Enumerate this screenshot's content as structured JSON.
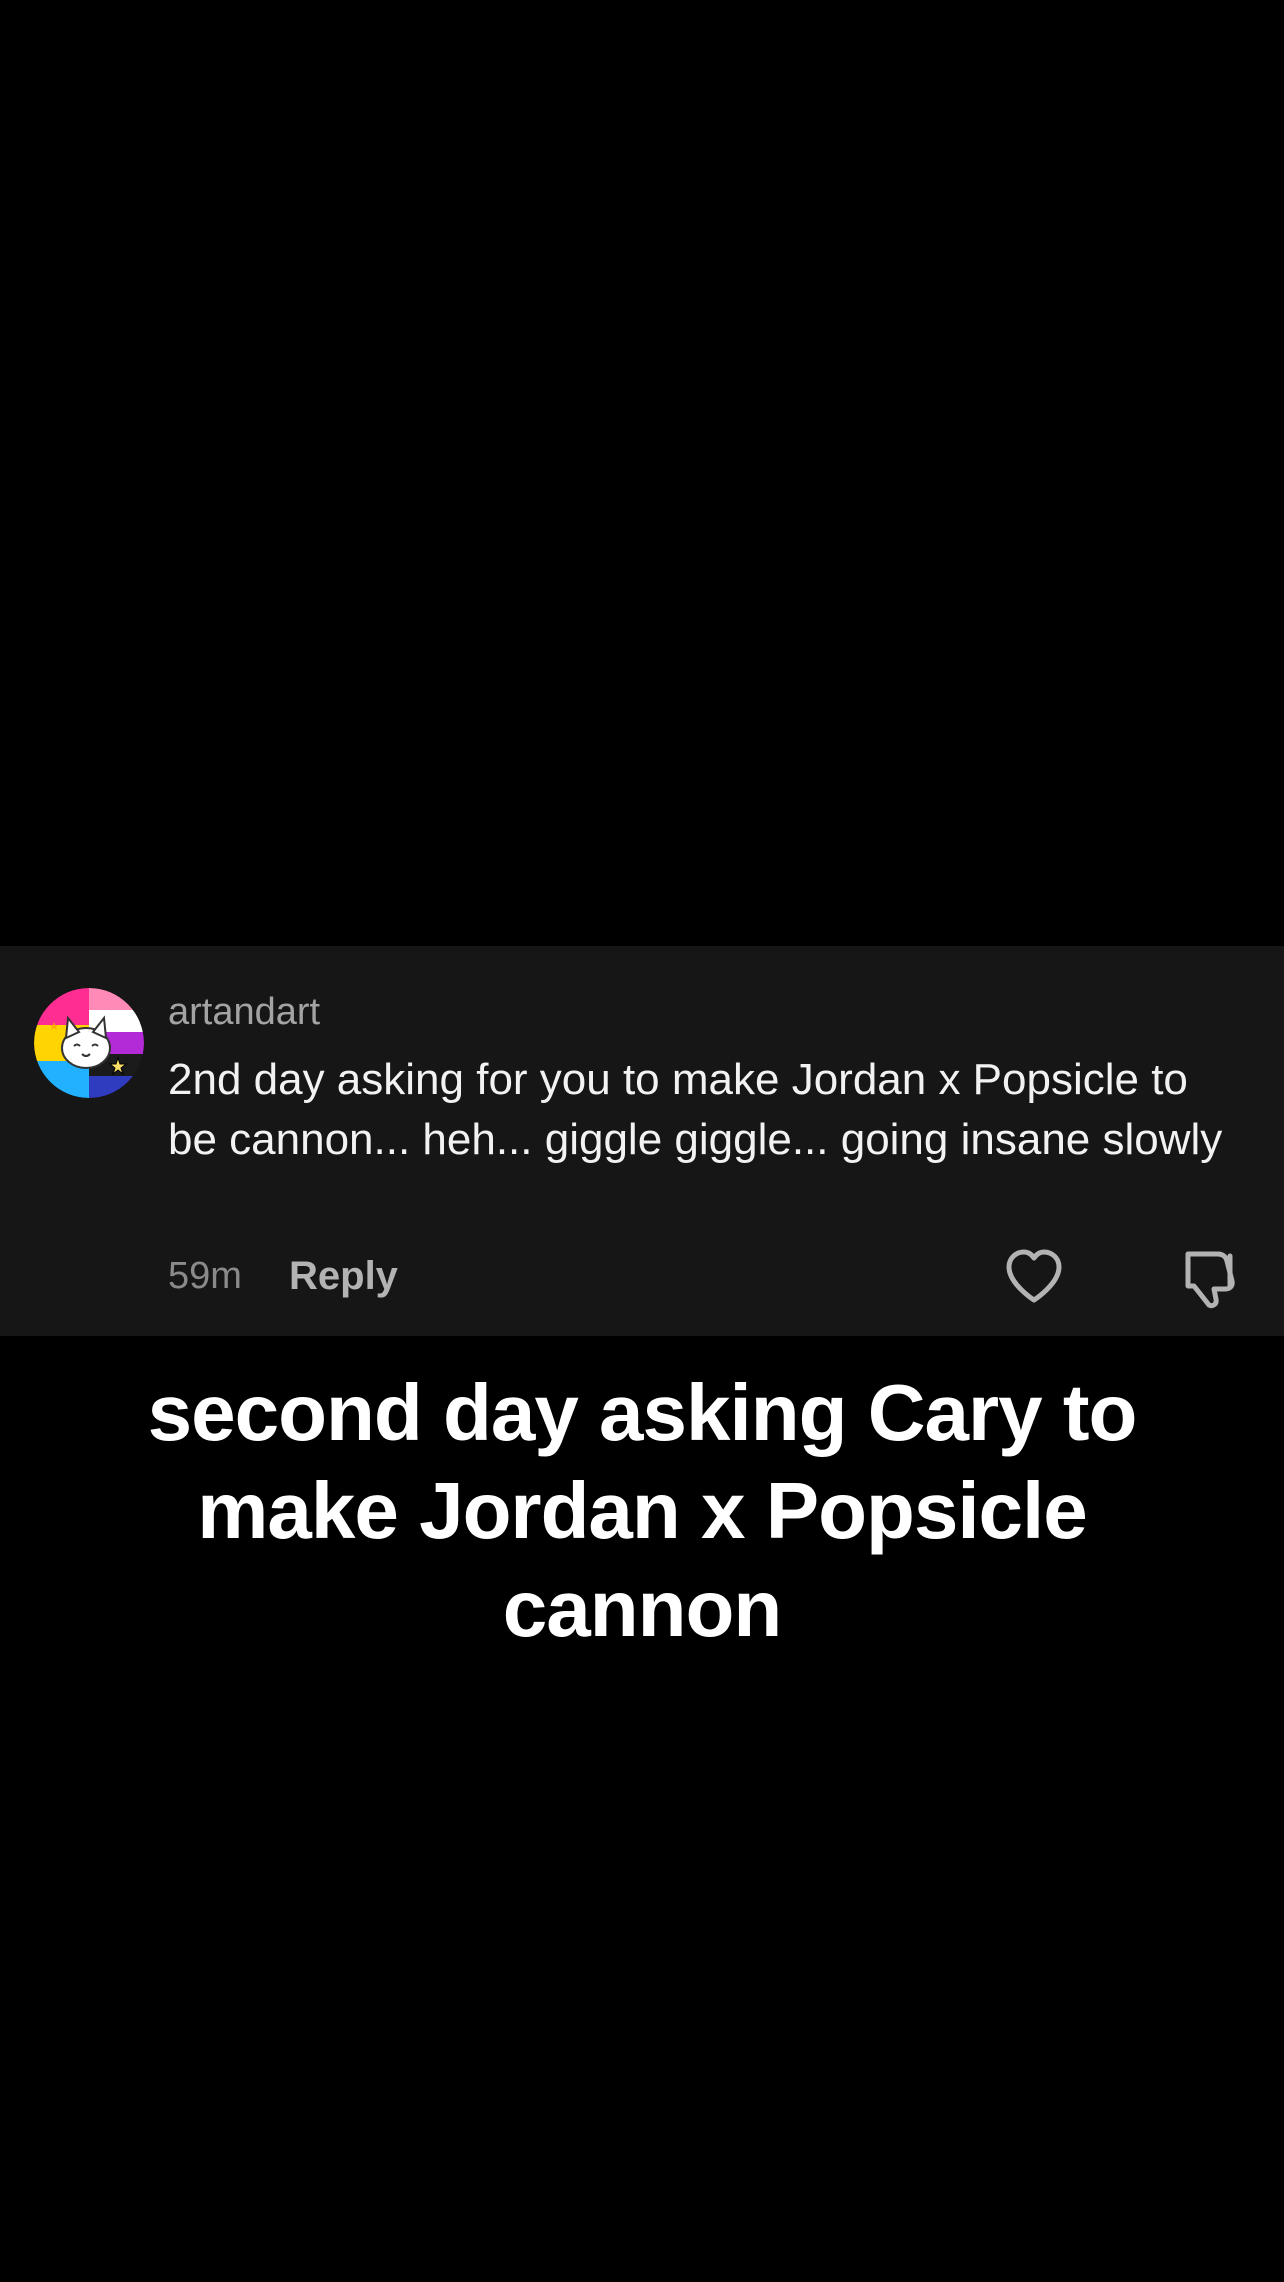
{
  "comment": {
    "username": "artandart",
    "text": "2nd day asking for you to make Jordan x Popsicle to be cannon... heh... giggle giggle... going insane slowly",
    "timestamp": "59m",
    "reply_label": "Reply",
    "avatar_icon": "pride-flag-cat-avatar",
    "like_icon": "heart-outline-icon",
    "dislike_icon": "thumbs-down-outline-icon"
  },
  "caption": {
    "lines": [
      "second day asking Cary to",
      "make Jordan x Popsicle",
      "cannon"
    ]
  },
  "colors": {
    "background": "#000000",
    "card": "#161616",
    "username": "#a3a3a3",
    "comment_text": "#f2f2f2",
    "caption": "#ffffff"
  }
}
